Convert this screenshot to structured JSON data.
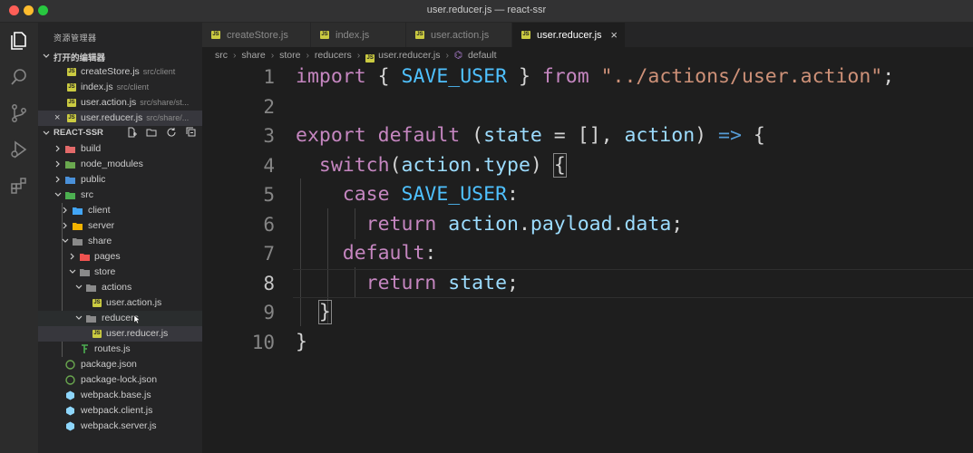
{
  "window": {
    "title": "user.reducer.js — react-ssr"
  },
  "explorer": {
    "title": "资源管理器",
    "open_editors": {
      "label": "打开的编辑器",
      "items": [
        {
          "name": "createStore.js",
          "desc": "src/client"
        },
        {
          "name": "index.js",
          "desc": "src/client"
        },
        {
          "name": "user.action.js",
          "desc": "src/share/st..."
        },
        {
          "name": "user.reducer.js",
          "desc": "src/share/..."
        }
      ]
    },
    "project": {
      "label": "REACT-SSR",
      "tree": [
        {
          "name": "build"
        },
        {
          "name": "node_modules"
        },
        {
          "name": "public"
        },
        {
          "name": "src"
        },
        {
          "name": "client"
        },
        {
          "name": "server"
        },
        {
          "name": "share"
        },
        {
          "name": "pages"
        },
        {
          "name": "store"
        },
        {
          "name": "actions"
        },
        {
          "name": "user.action.js"
        },
        {
          "name": "reducers"
        },
        {
          "name": "user.reducer.js"
        },
        {
          "name": "routes.js"
        },
        {
          "name": "package.json"
        },
        {
          "name": "package-lock.json"
        },
        {
          "name": "webpack.base.js"
        },
        {
          "name": "webpack.client.js"
        },
        {
          "name": "webpack.server.js"
        }
      ]
    }
  },
  "tabs": [
    {
      "label": "createStore.js"
    },
    {
      "label": "index.js"
    },
    {
      "label": "user.action.js"
    },
    {
      "label": "user.reducer.js",
      "close": "×"
    }
  ],
  "breadcrumbs": [
    "src",
    "share",
    "store",
    "reducers",
    "user.reducer.js",
    "default"
  ],
  "code": {
    "line_numbers": [
      "1",
      "2",
      "3",
      "4",
      "5",
      "6",
      "7",
      "8",
      "9",
      "10"
    ],
    "tokens": {
      "l1": {
        "import": "import",
        "lb": " { ",
        "name": "SAVE_USER",
        "rb": " } ",
        "from": "from",
        "sp": " ",
        "str": "\"../actions/user.action\"",
        "semi": ";"
      },
      "l3": {
        "export": "export",
        "sp1": " ",
        "default": "default",
        "p1": " (",
        "state": "state",
        "eq": " = [], ",
        "action": "action",
        "p2": ") ",
        "arrow": "=>",
        "ob": " {"
      },
      "l4": {
        "ind": "  ",
        "switch": "switch",
        "op": "(",
        "action": "action",
        "dot": ".",
        "type": "type",
        "cp": ") ",
        "ob": "{"
      },
      "l5": {
        "ind": "    ",
        "case": "case",
        "sp": " ",
        "name": "SAVE_USER",
        "colon": ":"
      },
      "l6": {
        "ind": "      ",
        "return": "return",
        "sp": " ",
        "action": "action",
        "d1": ".",
        "payload": "payload",
        "d2": ".",
        "data": "data",
        "semi": ";"
      },
      "l7": {
        "ind": "    ",
        "default": "default",
        "colon": ":"
      },
      "l8": {
        "ind": "      ",
        "return": "return",
        "sp": " ",
        "state": "state",
        "semi": ";"
      },
      "l9": {
        "ind": "  ",
        "cb": "}"
      },
      "l10": {
        "cb": "}"
      }
    }
  },
  "colors": {
    "keyword_control": "#c586c0",
    "keyword": "#569cd6",
    "variable": "#9cdcfe",
    "constant": "#4fc1ff",
    "string": "#ce9178",
    "js_badge": "#cbcb41"
  }
}
